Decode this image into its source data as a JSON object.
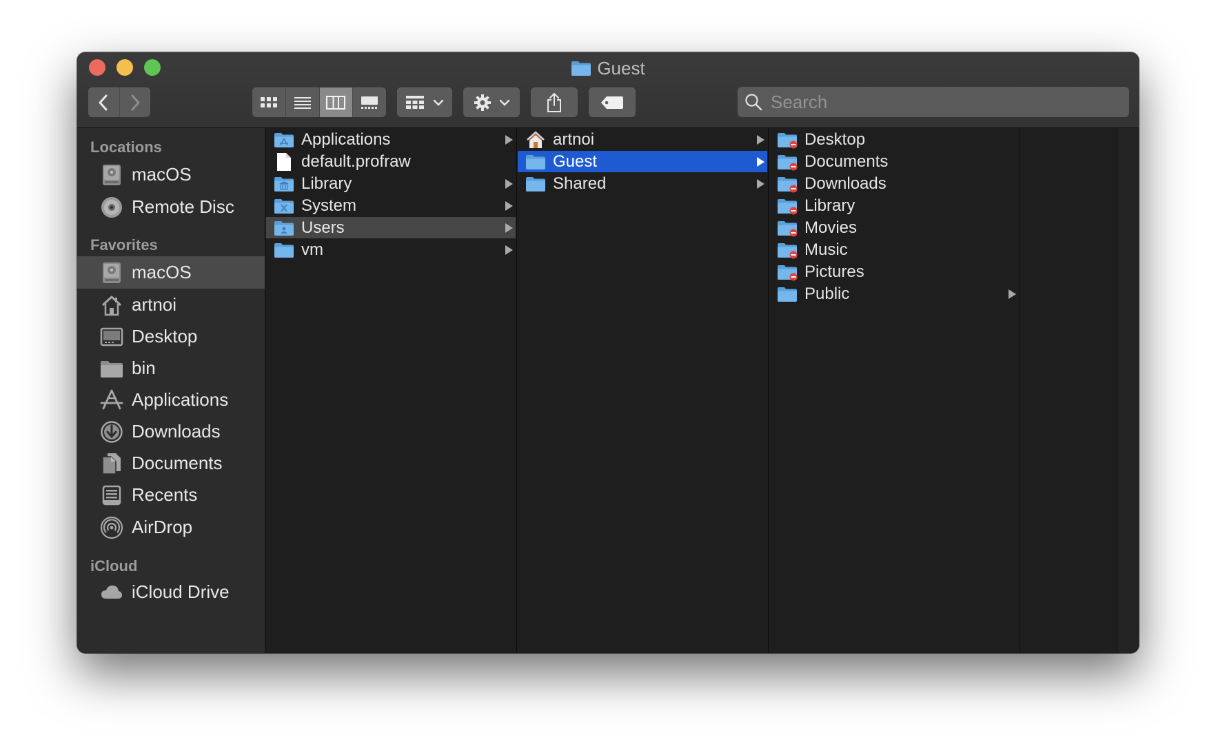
{
  "window": {
    "title": "Guest"
  },
  "toolbar": {
    "back_icon": "chevron-left-icon",
    "forward_icon": "chevron-right-icon",
    "view_modes": [
      "icon-view",
      "list-view",
      "column-view",
      "gallery-view"
    ],
    "active_view": "column-view",
    "search_placeholder": "Search"
  },
  "sidebar": {
    "sections": [
      {
        "heading": "Locations",
        "items": [
          {
            "label": "macOS",
            "icon": "hard-drive-icon"
          },
          {
            "label": "Remote Disc",
            "icon": "disc-icon"
          }
        ]
      },
      {
        "heading": "Favorites",
        "items": [
          {
            "label": "macOS",
            "icon": "hard-drive-icon",
            "selected": true
          },
          {
            "label": "artnoi",
            "icon": "home-icon"
          },
          {
            "label": "Desktop",
            "icon": "desktop-icon"
          },
          {
            "label": "bin",
            "icon": "folder-icon"
          },
          {
            "label": "Applications",
            "icon": "applications-icon"
          },
          {
            "label": "Downloads",
            "icon": "downloads-icon"
          },
          {
            "label": "Documents",
            "icon": "documents-icon"
          },
          {
            "label": "Recents",
            "icon": "recents-icon"
          },
          {
            "label": "AirDrop",
            "icon": "airdrop-icon"
          }
        ]
      },
      {
        "heading": "iCloud",
        "items": [
          {
            "label": "iCloud Drive",
            "icon": "cloud-icon"
          }
        ]
      }
    ]
  },
  "columns": [
    {
      "items": [
        {
          "label": "Applications",
          "icon": "applications-folder-icon",
          "has_children": true
        },
        {
          "label": "default.profraw",
          "icon": "file-icon",
          "has_children": false
        },
        {
          "label": "Library",
          "icon": "library-folder-icon",
          "has_children": true
        },
        {
          "label": "System",
          "icon": "system-folder-icon",
          "has_children": true
        },
        {
          "label": "Users",
          "icon": "users-folder-icon",
          "has_children": true,
          "state": "selected-inactive"
        },
        {
          "label": "vm",
          "icon": "folder-icon",
          "has_children": true
        }
      ]
    },
    {
      "items": [
        {
          "label": "artnoi",
          "icon": "home-icon",
          "has_children": true
        },
        {
          "label": "Guest",
          "icon": "folder-icon",
          "has_children": true,
          "state": "selected-active"
        },
        {
          "label": "Shared",
          "icon": "folder-icon",
          "has_children": true
        }
      ]
    },
    {
      "items": [
        {
          "label": "Desktop",
          "icon": "restricted-folder-icon",
          "has_children": false
        },
        {
          "label": "Documents",
          "icon": "restricted-folder-icon",
          "has_children": false
        },
        {
          "label": "Downloads",
          "icon": "restricted-folder-icon",
          "has_children": false
        },
        {
          "label": "Library",
          "icon": "restricted-folder-icon",
          "has_children": false
        },
        {
          "label": "Movies",
          "icon": "restricted-folder-icon",
          "has_children": false
        },
        {
          "label": "Music",
          "icon": "restricted-folder-icon",
          "has_children": false
        },
        {
          "label": "Pictures",
          "icon": "restricted-folder-icon",
          "has_children": false
        },
        {
          "label": "Public",
          "icon": "folder-icon",
          "has_children": true
        }
      ]
    }
  ],
  "colors": {
    "selection_blue": "#1e5bd2",
    "folder_blue": "#6aaee8",
    "restricted_red": "#e0443e"
  }
}
